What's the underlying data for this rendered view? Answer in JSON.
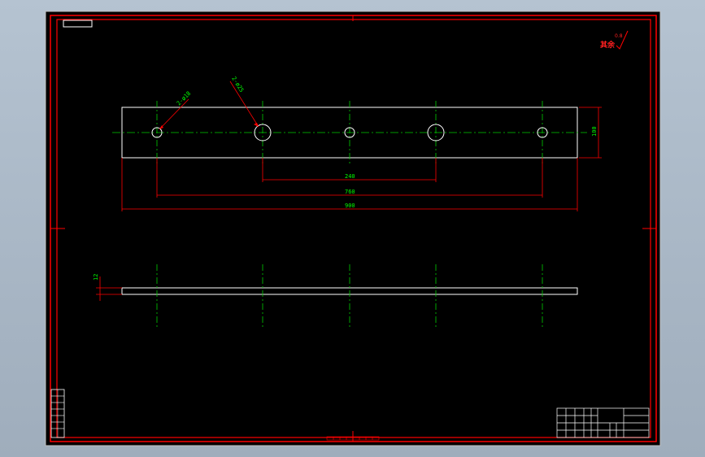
{
  "colors": {
    "desktop": "#a9b7c6",
    "sheet": "#000000",
    "frame": "#ff0000",
    "outline": "#ffffff",
    "centerline": "#00cc00",
    "dimension": "#ff0000",
    "dimension_text": "#00ff00"
  },
  "drawing": {
    "roughness_label": "其余",
    "roughness_value": "0.8",
    "hole_callouts": {
      "small": "2-ø18",
      "large": "2-ø25"
    },
    "dimensions": {
      "height": "100",
      "inner_spacing": "240",
      "outer_spacing": "760",
      "overall_length": "900",
      "thickness": "12"
    }
  }
}
